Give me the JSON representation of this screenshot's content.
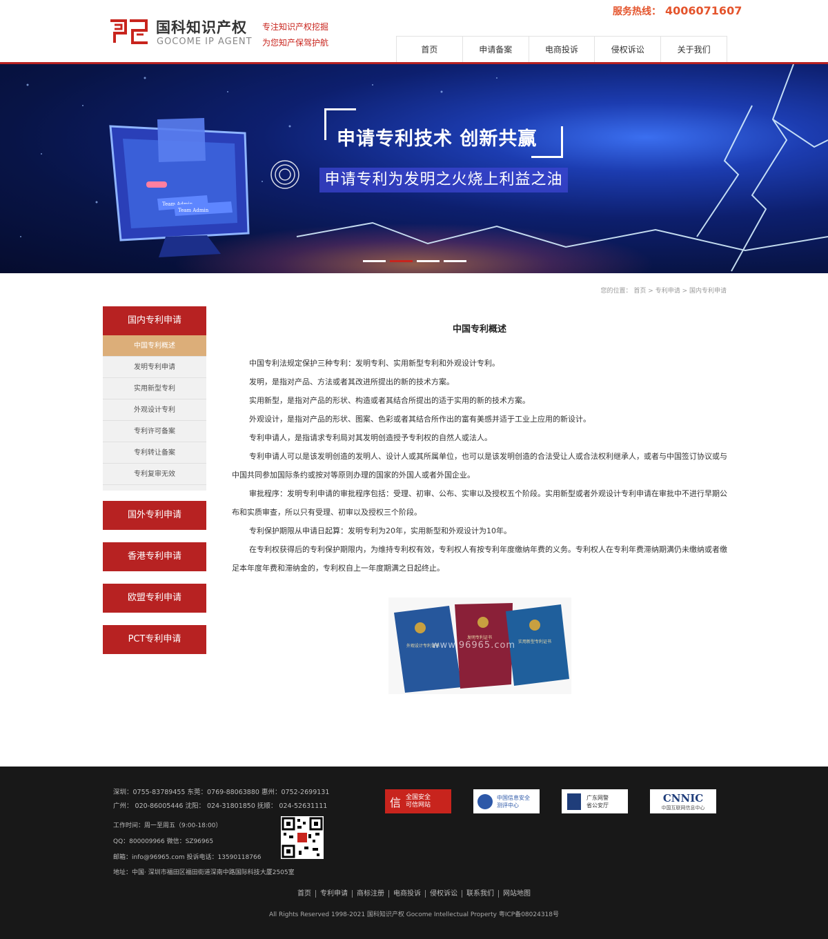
{
  "header": {
    "logo_cn": "国科知识产权",
    "logo_en": "GOCOME IP AGENT",
    "slogan_line1": "专注知识产权挖掘",
    "slogan_line2": "为您知产保驾护航",
    "hotline_label": "服务热线：",
    "hotline_number": "4006071607",
    "nav": [
      "首页",
      "申请备案",
      "电商投诉",
      "侵权诉讼",
      "关于我们"
    ]
  },
  "banner": {
    "title": "申请专利技术  创新共赢",
    "subtitle": "申请专利为发明之火烧上利益之油",
    "card1": "Team Admin",
    "card2": "Team Admin",
    "active_slide": 2
  },
  "breadcrumb": {
    "prefix": "您的位置：",
    "items": [
      "首页",
      "专利申请",
      "国内专利申请"
    ]
  },
  "sidebar": {
    "main_title": "国内专利申请",
    "items": [
      "中国专利概述",
      "发明专利申请",
      "实用新型专利",
      "外观设计专利",
      "专利许可备案",
      "专利转让备案",
      "专利复审无效"
    ],
    "sections": [
      "国外专利申请",
      "香港专利申请",
      "欧盟专利申请",
      "PCT专利申请"
    ]
  },
  "article": {
    "title": "中国专利概述",
    "paragraphs": [
      "中国专利法规定保护三种专利：发明专利、实用新型专利和外观设计专利。",
      "发明，是指对产品、方法或者其改进所提出的新的技术方案。",
      "实用新型，是指对产品的形状、构造或者其结合所提出的适于实用的新的技术方案。",
      "外观设计，是指对产品的形状、图案、色彩或者其结合所作出的富有美感并适于工业上应用的新设计。",
      "专利申请人，是指请求专利局对其发明创造授予专利权的自然人或法人。",
      "专利申请人可以是该发明创造的发明人、设计人或其所属单位，也可以是该发明创造的合法受让人或合法权利继承人，或者与中国签订协议或与中国共同参加国际条约或按对等原则办理的国家的外国人或者外国企业。",
      "审批程序：发明专利申请的审批程序包括：受理、初审、公布、实审以及授权五个阶段。实用新型或者外观设计专利申请在审批中不进行早期公布和实质审查，所以只有受理、初审以及授权三个阶段。",
      "专利保护期限从申请日起算：发明专利为20年，实用新型和外观设计为10年。",
      "在专利权获得后的专利保护期限内，为维持专利权有效，专利权人有按专利年度缴纳年费的义务。专利权人在专利年费滞纳期满仍未缴纳或者缴足本年度年费和滞纳金的，专利权自上一年度期满之日起终止。"
    ],
    "watermark": "www.96965.com",
    "cert_labels": [
      "外观设计专利证书",
      "发明专利证书",
      "实用新型专利证书"
    ]
  },
  "footer": {
    "phones_line1": "深圳：0755-83789455   东莞：0769-88063880   惠州：0752-2699131",
    "phones_line2": "广州：  020-86005446   沈阳：  024-31801850   抚顺：  024-52631111",
    "hours": "工作时间：周一至周五（9:00-18:00）",
    "qq": "QQ：800009966 微信：SZ96965",
    "email": "邮箱：info@96965.com 投诉电话：13590118766",
    "address": "地址：中国· 深圳市福田区福田街道深南中路国际科技大厦2505室",
    "badges": [
      {
        "line1": "全国安全",
        "line2": "可信网站"
      },
      {
        "line1": "中国信息安全",
        "line2": "测评中心"
      },
      {
        "line1": "广东网警",
        "line2": "省公安厅"
      },
      {
        "line1": "CNNIC",
        "line2": "中国互联网信息中心"
      }
    ],
    "links": [
      "首页",
      "专利申请",
      "商标注册",
      "电商投诉",
      "侵权诉讼",
      "联系我们",
      "网站地图"
    ],
    "copyright": "All Rights Reserved 1998-2021 国科知识产权 Gocome Intellectual Property  粤ICP备08024318号"
  },
  "colors": {
    "brand_red": "#b72222",
    "accent_orange": "#e4542c",
    "active_tan": "#dcae79",
    "footer_bg": "#181818"
  }
}
